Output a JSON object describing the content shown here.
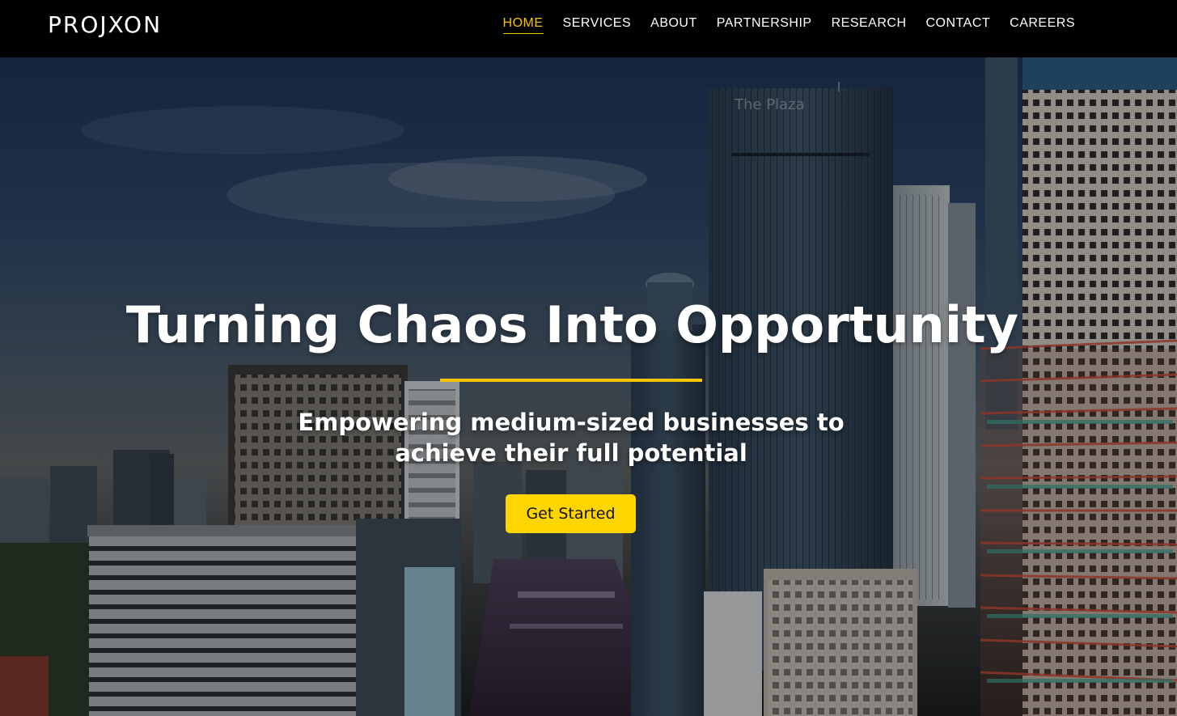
{
  "brand": {
    "logo_text": "PROJXON"
  },
  "nav": {
    "items": [
      {
        "label": "HOME",
        "active": true
      },
      {
        "label": "SERVICES",
        "active": false
      },
      {
        "label": "ABOUT",
        "active": false
      },
      {
        "label": "PARTNERSHIP",
        "active": false
      },
      {
        "label": "RESEARCH",
        "active": false
      },
      {
        "label": "CONTACT",
        "active": false
      },
      {
        "label": "CAREERS",
        "active": false
      }
    ]
  },
  "hero": {
    "title": "Turning Chaos Into Opportunity",
    "subtitle_line1": "Empowering medium-sized businesses to",
    "subtitle_line2": "achieve their full potential",
    "cta_label": "Get Started",
    "building_sign": "The Plaza"
  },
  "colors": {
    "accent": "#f5c400",
    "cta_background": "#ffd500",
    "nav_background": "#000000"
  }
}
